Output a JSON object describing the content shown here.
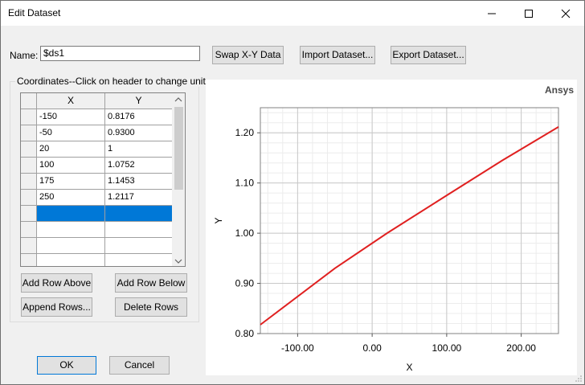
{
  "window": {
    "title": "Edit Dataset"
  },
  "name_label": "Name:",
  "name_value": "$ds1",
  "buttons": {
    "swap": "Swap X-Y Data",
    "import": "Import Dataset...",
    "export": "Export Dataset...",
    "add_above": "Add Row Above",
    "add_below": "Add Row Below",
    "append": "Append Rows...",
    "delete": "Delete Rows",
    "ok": "OK",
    "cancel": "Cancel"
  },
  "group_label": "Coordinates--Click on header to change unit",
  "table": {
    "headers": [
      "X",
      "Y"
    ],
    "rows": [
      [
        "-150",
        "0.8176"
      ],
      [
        "-50",
        "0.9300"
      ],
      [
        "20",
        "1"
      ],
      [
        "100",
        "1.0752"
      ],
      [
        "175",
        "1.1453"
      ],
      [
        "250",
        "1.2117"
      ],
      [
        "",
        ""
      ],
      [
        "",
        ""
      ],
      [
        "",
        ""
      ],
      [
        "",
        ""
      ]
    ],
    "selected_row": 6
  },
  "brand": "Ansys",
  "chart_data": {
    "type": "line",
    "xlabel": "X",
    "ylabel": "Y",
    "xlim": [
      -150,
      250
    ],
    "ylim": [
      0.8,
      1.25
    ],
    "x_ticks": [
      "-100.00",
      "0.00",
      "100.00",
      "200.00"
    ],
    "y_ticks": [
      "0.80",
      "0.90",
      "1.00",
      "1.10",
      "1.20"
    ],
    "grid": true,
    "series": [
      {
        "color": "#e02020",
        "x": [
          -150,
          -50,
          20,
          100,
          175,
          250
        ],
        "y": [
          0.8176,
          0.93,
          1.0,
          1.0752,
          1.1453,
          1.2117
        ]
      }
    ]
  }
}
